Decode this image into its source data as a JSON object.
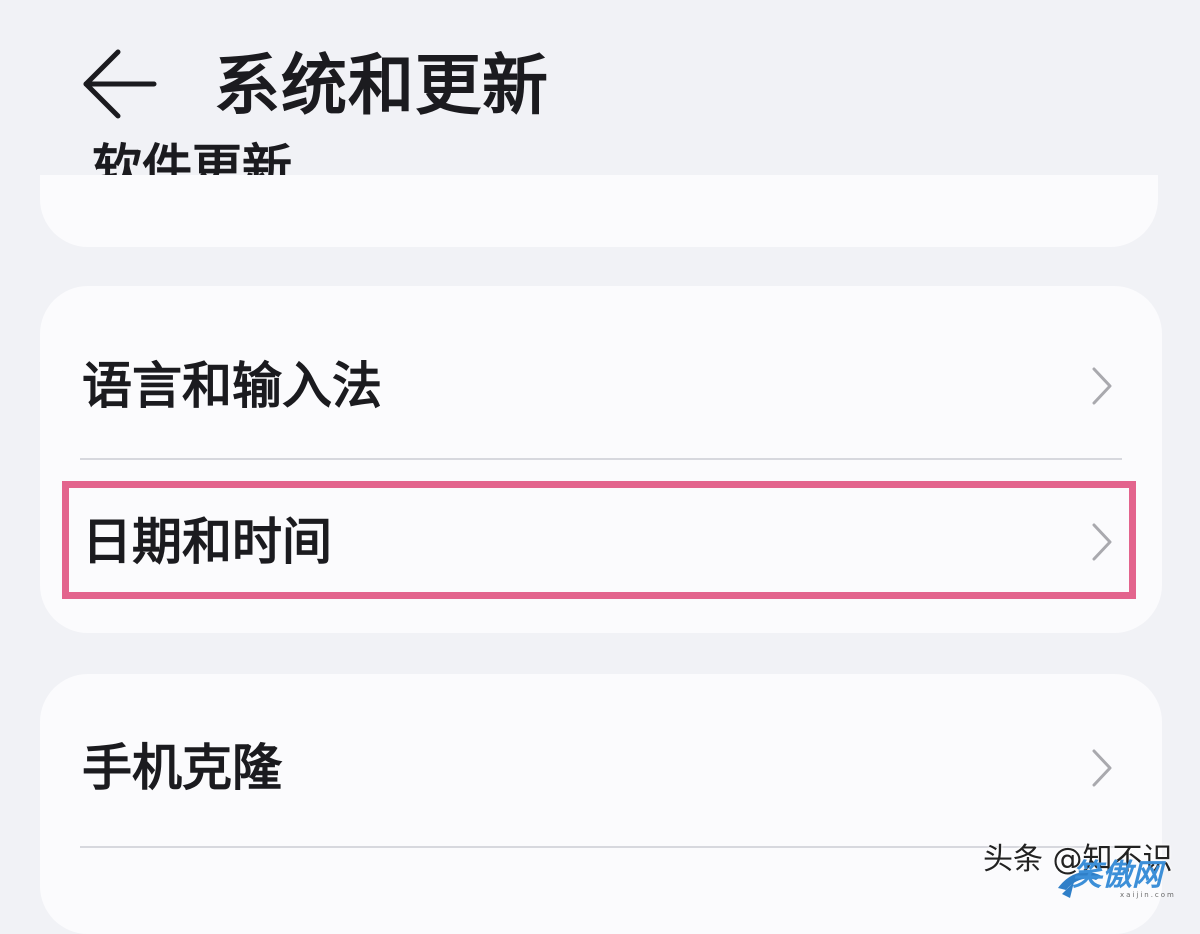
{
  "header": {
    "back_icon": "arrow-left-icon",
    "title": "系统和更新"
  },
  "scrolled_item": {
    "partial_label": "软件更新"
  },
  "group_language_time": {
    "items": [
      {
        "label": "语言和输入法",
        "icon": "chevron-right-icon"
      },
      {
        "label": "日期和时间",
        "icon": "chevron-right-icon",
        "highlighted": true
      }
    ]
  },
  "group_clone": {
    "items": [
      {
        "label": "手机克隆",
        "icon": "chevron-right-icon"
      }
    ]
  },
  "watermark": {
    "text": "头条 @知不识",
    "site_logo": "笑傲网",
    "site_url": "xaijin.com"
  },
  "colors": {
    "background": "#f1f2f6",
    "card": "#fbfbfd",
    "highlight": "#e3648d",
    "text": "#1b1b1f",
    "chevron": "#a9a9ae"
  }
}
